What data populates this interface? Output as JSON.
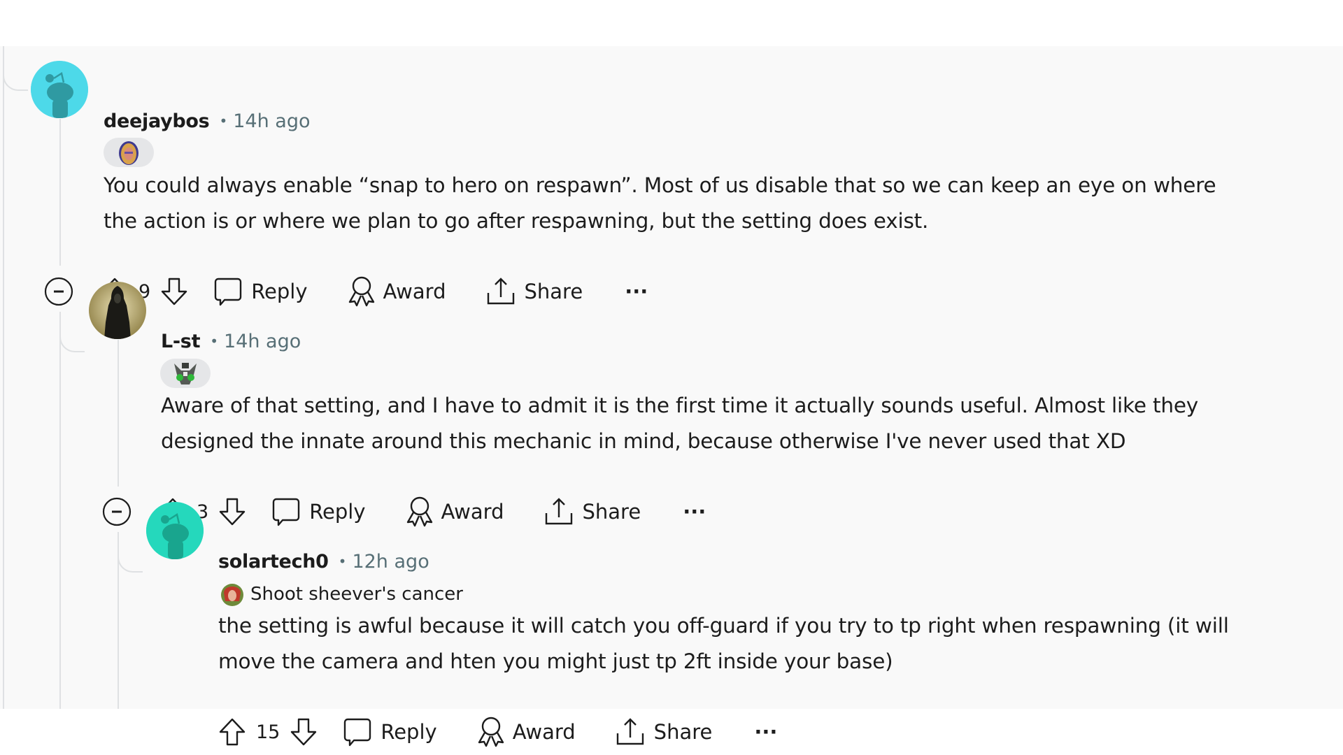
{
  "comments": [
    {
      "username": "deejaybos",
      "separator": "•",
      "time": "14h ago",
      "avatar": {
        "type": "snoo",
        "bg_color": "#4dd9e9",
        "fg_color": "#2f9aa2"
      },
      "flair": {
        "type": "icon",
        "icon": "character-portrait-icon"
      },
      "body_lines": [
        "You could always enable “snap to hero on respawn”. Most of us disable that so we can keep an eye on where",
        "the action is or where we plan to go after respawning, but the setting does exist."
      ],
      "votes": "9",
      "collapsible": true,
      "actions": {
        "reply": "Reply",
        "award": "Award",
        "share": "Share",
        "more": "···"
      }
    },
    {
      "username": "L-st",
      "separator": "•",
      "time": "14h ago",
      "avatar": {
        "type": "image",
        "description": "hooded dark figure on gold background"
      },
      "flair": {
        "type": "icon",
        "icon": "green-mech-portrait-icon"
      },
      "body_lines": [
        "Aware of that setting, and I have to admit it is the first time it actually sounds useful. Almost like they",
        "designed the innate around this mechanic in mind, because otherwise I've never used that XD"
      ],
      "votes": "3",
      "collapsible": true,
      "actions": {
        "reply": "Reply",
        "award": "Award",
        "share": "Share",
        "more": "···"
      }
    },
    {
      "username": "solartech0",
      "separator": "•",
      "time": "12h ago",
      "avatar": {
        "type": "snoo",
        "bg_color": "#25d8bc",
        "fg_color": "#19a58e"
      },
      "flair": {
        "type": "text",
        "icon": "red-haired-hero-portrait-icon",
        "text": "Shoot sheever's cancer"
      },
      "body_lines": [
        "the setting is awful because it will catch you off-guard if you try to tp right when respawning (it will",
        "move the camera and hten you might just tp 2ft inside your base)"
      ],
      "votes": "15",
      "collapsible": false,
      "actions": {
        "reply": "Reply",
        "award": "Award",
        "share": "Share",
        "more": "···"
      }
    }
  ]
}
